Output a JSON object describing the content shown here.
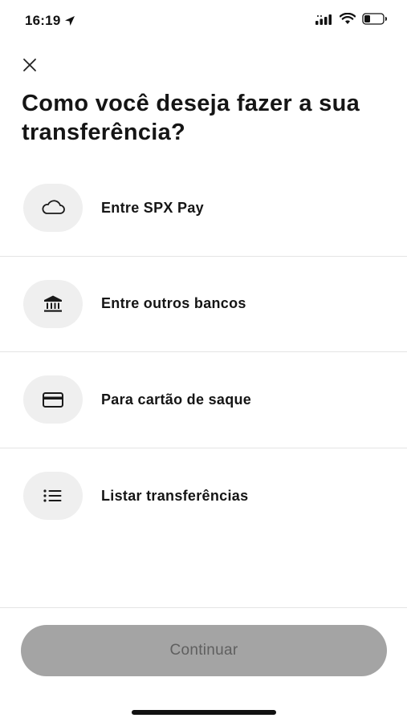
{
  "status_bar": {
    "time": "16:19",
    "icons": [
      "location-arrow-icon",
      "signal-icon",
      "wifi-icon",
      "battery-icon"
    ]
  },
  "header": {
    "close_icon": "close-icon",
    "title": "Como você deseja fazer a sua transferência?"
  },
  "options": [
    {
      "label": "Entre SPX Pay",
      "icon": "cloud-icon"
    },
    {
      "label": "Entre outros bancos",
      "icon": "bank-icon"
    },
    {
      "label": "Para cartão de saque",
      "icon": "card-icon"
    },
    {
      "label": "Listar transferências",
      "icon": "list-icon"
    }
  ],
  "footer": {
    "continue_label": "Continuar"
  },
  "colors": {
    "icon_circle_bg": "#efefef",
    "button_disabled_bg": "#a4a4a4",
    "button_disabled_text": "#5f5f5f",
    "divider": "#e4e4e4"
  }
}
